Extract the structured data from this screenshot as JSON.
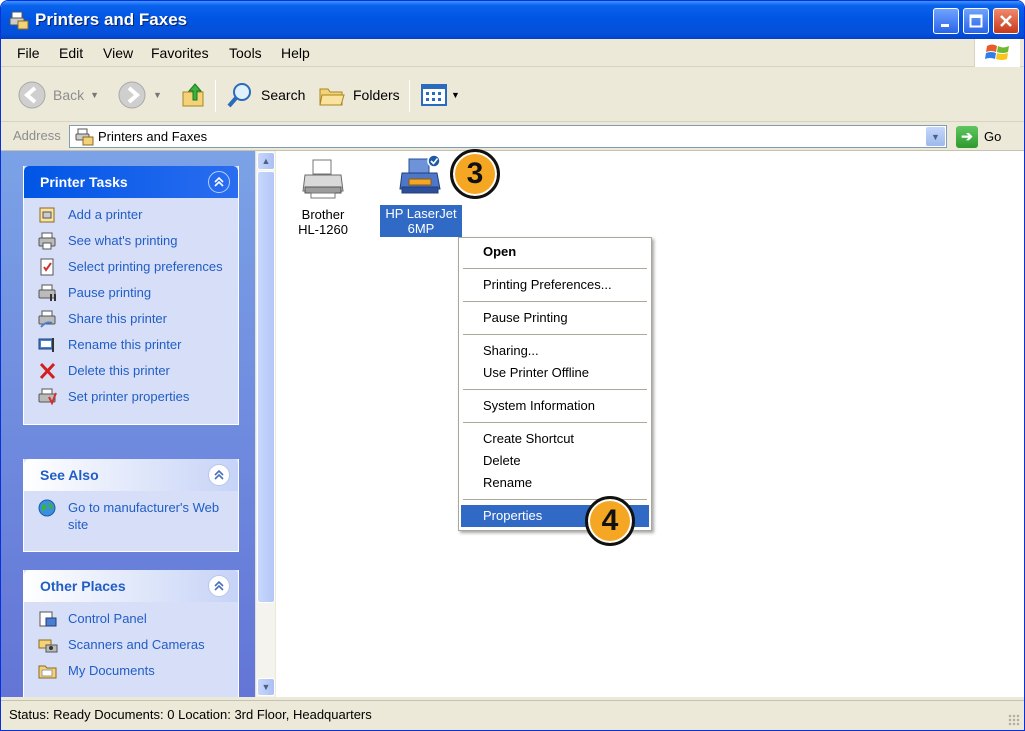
{
  "window": {
    "title": "Printers and Faxes"
  },
  "menubar": {
    "items": [
      "File",
      "Edit",
      "View",
      "Favorites",
      "Tools",
      "Help"
    ]
  },
  "toolbar": {
    "back_label": "Back",
    "search_label": "Search",
    "folders_label": "Folders"
  },
  "address": {
    "label": "Address",
    "value": "Printers and Faxes",
    "go_label": "Go"
  },
  "taskpane": {
    "printer_tasks": {
      "title": "Printer Tasks",
      "items": [
        {
          "label": "Add a printer",
          "icon": "add-printer-icon"
        },
        {
          "label": "See what's printing",
          "icon": "print-queue-icon"
        },
        {
          "label": "Select printing preferences",
          "icon": "preferences-icon"
        },
        {
          "label": "Pause printing",
          "icon": "pause-printer-icon"
        },
        {
          "label": "Share this printer",
          "icon": "share-printer-icon"
        },
        {
          "label": "Rename this printer",
          "icon": "rename-icon"
        },
        {
          "label": "Delete this printer",
          "icon": "delete-icon"
        },
        {
          "label": "Set printer properties",
          "icon": "properties-icon"
        }
      ]
    },
    "see_also": {
      "title": "See Also",
      "items": [
        {
          "label": "Go to manufacturer's Web site",
          "icon": "globe-icon"
        }
      ]
    },
    "other_places": {
      "title": "Other Places",
      "items": [
        {
          "label": "Control Panel",
          "icon": "control-panel-icon"
        },
        {
          "label": "Scanners and Cameras",
          "icon": "scanner-icon"
        },
        {
          "label": "My Documents",
          "icon": "folder-icon"
        }
      ]
    }
  },
  "printers": [
    {
      "name_line1": "Brother",
      "name_line2": "HL-1260",
      "selected": false
    },
    {
      "name_line1": "HP LaserJet",
      "name_line2": "6MP",
      "selected": true,
      "default": true
    }
  ],
  "callouts": [
    "3",
    "4"
  ],
  "context_menu": {
    "groups": [
      [
        "Open"
      ],
      [
        "Printing Preferences..."
      ],
      [
        "Pause Printing"
      ],
      [
        "Sharing...",
        "Use Printer Offline"
      ],
      [
        "System Information"
      ],
      [
        "Create Shortcut",
        "Delete",
        "Rename"
      ],
      [
        "Properties"
      ]
    ],
    "default_item": "Open",
    "highlighted_item": "Properties"
  },
  "status": {
    "text": "Status: Ready Documents: 0 Location: 3rd Floor, Headquarters"
  },
  "colors": {
    "title_blue": "#0054e3",
    "selection": "#316ac5",
    "task_link": "#215dc6",
    "callout": "#f5a623"
  }
}
